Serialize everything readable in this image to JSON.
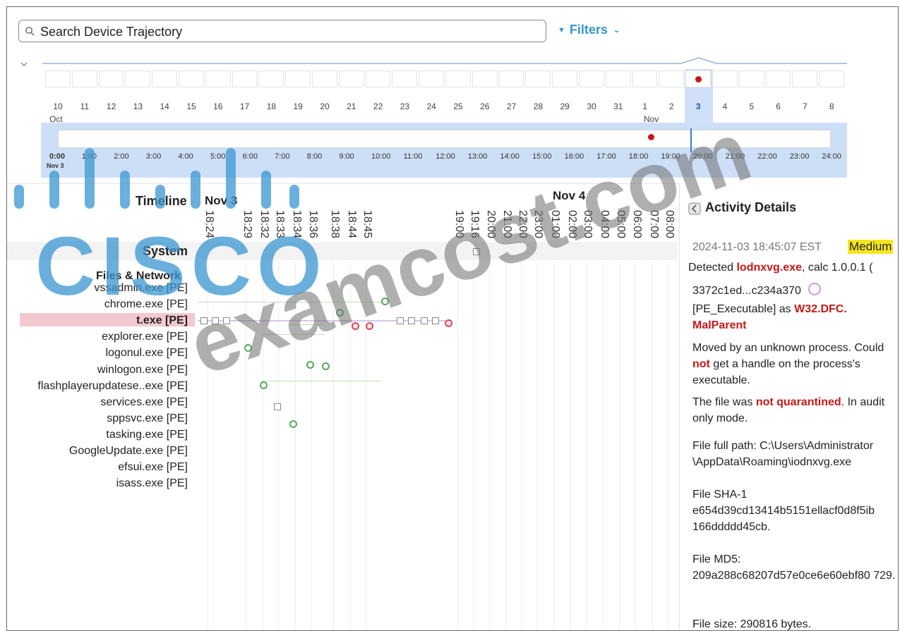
{
  "search": {
    "placeholder": "Search Device Trajectory",
    "value": ""
  },
  "filters": {
    "label": "Filters"
  },
  "date_strip": {
    "days": [
      "10",
      "11",
      "12",
      "13",
      "14",
      "15",
      "16",
      "17",
      "18",
      "19",
      "20",
      "21",
      "22",
      "23",
      "24",
      "25",
      "26",
      "27",
      "28",
      "29",
      "30",
      "31",
      "1",
      "2",
      "3",
      "4",
      "5",
      "6",
      "7",
      "8"
    ],
    "selected_day": "3",
    "month_labels": [
      {
        "text": "Oct"
      },
      {
        "text": "Nov"
      }
    ]
  },
  "hour_range": {
    "hours": [
      "0:00",
      "1:00",
      "2:00",
      "3:00",
      "4:00",
      "5:00",
      "6:00",
      "7:00",
      "8:00",
      "9:00",
      "10:00",
      "11:00",
      "12:00",
      "13:00",
      "14:00",
      "15:00",
      "16:00",
      "17:00",
      "18:00",
      "19:00",
      "20:00",
      "21:00",
      "22:00",
      "23:00",
      "24:00"
    ],
    "date": "Nov 3"
  },
  "timeline": {
    "label": "Timeline",
    "day1": "Nov 3",
    "day2": "Nov 4",
    "ticks_day1": [
      "18:24",
      "18:29",
      "18:32",
      "18:33",
      "18:34",
      "18:36",
      "18:38",
      "18:44",
      "18:45"
    ],
    "ticks_day2": [
      "19:00",
      "19:16",
      "20:00",
      "21:00",
      "22:00",
      "23:00",
      "01:00",
      "02:00",
      "03:00",
      "04:00",
      "05:00",
      "06:00",
      "07:00",
      "08:00"
    ]
  },
  "sections": {
    "system": "System",
    "files_network": "Files & Network"
  },
  "processes": [
    "vssadmin.exe [PE]",
    "chrome.exe [PE]",
    "t.exe [PE]",
    "explorer.exe [PE]",
    "logonul.exe [PE]",
    "winlogon.exe [PE]",
    "flashplayerupdatese..exe [PE]",
    "services.exe [PE]",
    "sppsvc.exe [PE]",
    "tasking.exe [PE]",
    "GoogleUpdate.exe [PE]",
    "efsui.exe [PE]",
    "isass.exe [PE]"
  ],
  "selected_process": "t.exe [PE]",
  "details": {
    "title": "Activity Details",
    "timestamp": "2024-11-03 18:45:07 EST",
    "severity": "Medium",
    "detected_prefix": "Detected ",
    "detected_file": "lodnxvg.exe",
    "detected_suffix": ", calc 1.0.0.1 (",
    "hash_short": "3372c1ed...c234a370",
    "pe_prefix": "[PE_Executable] as ",
    "threat": "W32.DFC. MalParent",
    "moved_prefix": "Moved by an unknown process. Could ",
    "moved_not": "not",
    "moved_suffix": " get a handle on the process's executable.",
    "quar_prefix": "The file was ",
    "quar_not": "not quarantined",
    "quar_suffix": ". In audit only mode.",
    "path_label": "File full path: C:\\Users\\Administrator \\AppData\\Roaming\\iodnxvg.exe",
    "sha1_label": "File SHA-1",
    "sha1": "e654d39cd13414b5151ellacf0d8f5ib 166ddddd45cb.",
    "md5_label": "File MD5:",
    "md5": "209a288c68207d57e0ce6e60ebf80 729.",
    "size": "File size: 290816 bytes."
  },
  "watermark": {
    "logo": "CISCO",
    "text": "examcost.com"
  },
  "colors": {
    "accent": "#3b95c9",
    "selection": "#cfe0f7",
    "alert": "#c81818",
    "severity_medium": "#f6e61e"
  }
}
